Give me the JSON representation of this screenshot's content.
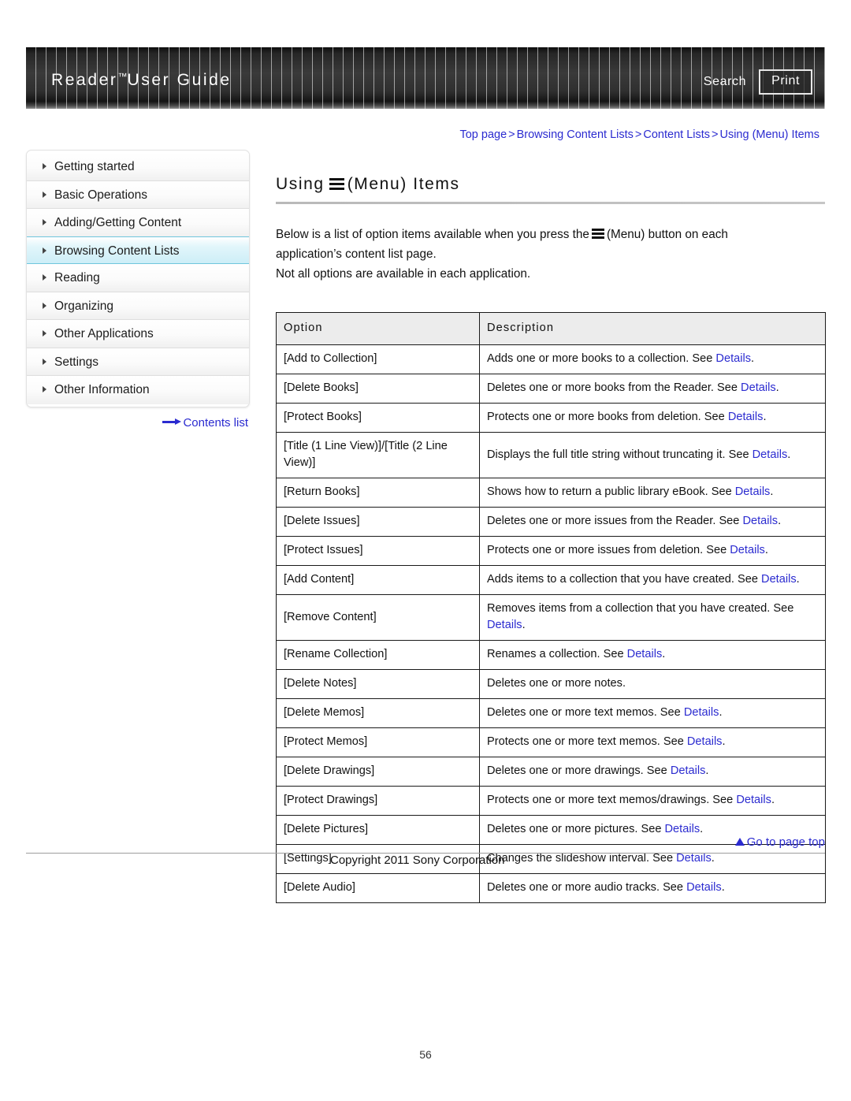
{
  "header": {
    "title": "Reader",
    "title_tm": "™",
    "title_rest": "User Guide",
    "search_label": "Search",
    "print_label": "Print"
  },
  "breadcrumb": {
    "separator": ">",
    "items": [
      "Top page",
      "Browsing Content Lists",
      "Content Lists",
      "Using (Menu) Items"
    ]
  },
  "sidebar": {
    "items": [
      {
        "label": "Getting started",
        "active": false
      },
      {
        "label": "Basic Operations",
        "active": false
      },
      {
        "label": "Adding/Getting Content",
        "active": false
      },
      {
        "label": "Browsing Content Lists",
        "active": true
      },
      {
        "label": "Reading",
        "active": false
      },
      {
        "label": "Organizing",
        "active": false
      },
      {
        "label": "Other Applications",
        "active": false
      },
      {
        "label": "Settings",
        "active": false
      },
      {
        "label": "Other Information",
        "active": false
      }
    ],
    "contents_list_label": "Contents list"
  },
  "main": {
    "title_prefix": "Using",
    "title_suffix": "(Menu) Items",
    "intro_line1_a": "Below is a list of option items available when you press the",
    "intro_line1_b": "(Menu) button on each",
    "intro_line2": "application’s content list page.",
    "intro_line3": "Not all options are available in each application.",
    "table": {
      "columns": [
        "Option",
        "Description"
      ],
      "rows": [
        {
          "option": "[Add to Collection]",
          "desc_before": "Adds one or more books to a collection. See ",
          "link": "Details",
          "desc_after": "."
        },
        {
          "option": "[Delete Books]",
          "desc_before": "Deletes one or more books from the Reader. See ",
          "link": "Details",
          "desc_after": "."
        },
        {
          "option": "[Protect Books]",
          "desc_before": "Protects one or more books from deletion. See ",
          "link": "Details",
          "desc_after": "."
        },
        {
          "option": "[Title (1 Line View)]/[Title (2 Line View)]",
          "desc_before": "Displays the full title string without truncating it. See ",
          "link": "Details",
          "desc_after": "."
        },
        {
          "option": "[Return Books]",
          "desc_before": "Shows how to return a public library eBook. See ",
          "link": "Details",
          "desc_after": "."
        },
        {
          "option": "[Delete Issues]",
          "desc_before": "Deletes one or more issues from the Reader. See ",
          "link": "Details",
          "desc_after": "."
        },
        {
          "option": "[Protect Issues]",
          "desc_before": "Protects one or more issues from deletion. See ",
          "link": "Details",
          "desc_after": "."
        },
        {
          "option": "[Add Content]",
          "desc_before": "Adds items to a collection that you have created. See ",
          "link": "Details",
          "desc_after": "."
        },
        {
          "option": "[Remove Content]",
          "desc_before": "Removes items from a collection that you have created. See ",
          "link": "Details",
          "desc_after": "."
        },
        {
          "option": "[Rename Collection]",
          "desc_before": "Renames a collection. See ",
          "link": "Details",
          "desc_after": "."
        },
        {
          "option": "[Delete Notes]",
          "desc_before": "Deletes one or more notes.",
          "link": "",
          "desc_after": ""
        },
        {
          "option": "[Delete Memos]",
          "desc_before": "Deletes one or more text memos. See ",
          "link": "Details",
          "desc_after": "."
        },
        {
          "option": "[Protect Memos]",
          "desc_before": "Protects one or more text memos. See ",
          "link": "Details",
          "desc_after": "."
        },
        {
          "option": "[Delete Drawings]",
          "desc_before": "Deletes one or more drawings. See ",
          "link": "Details",
          "desc_after": "."
        },
        {
          "option": "[Protect Drawings]",
          "desc_before": "Protects one or more text memos/drawings. See ",
          "link": "Details",
          "desc_after": "."
        },
        {
          "option": "[Delete Pictures]",
          "desc_before": "Deletes one or more pictures. See ",
          "link": "Details",
          "desc_after": "."
        },
        {
          "option": "[Settings]",
          "desc_before": "Changes the slideshow interval. See ",
          "link": "Details",
          "desc_after": "."
        },
        {
          "option": "[Delete Audio]",
          "desc_before": "Deletes one or more audio tracks. See ",
          "link": "Details",
          "desc_after": "."
        }
      ]
    }
  },
  "footer": {
    "go_to_top_label": "Go to page top",
    "copyright": "Copyright 2011 Sony Corporation",
    "page_number": "56"
  },
  "colors": {
    "link": "#2b2bd0",
    "active_nav": "#cdeef7",
    "active_nav_border": "#6fc6dd",
    "table_header_bg": "#ececec"
  }
}
